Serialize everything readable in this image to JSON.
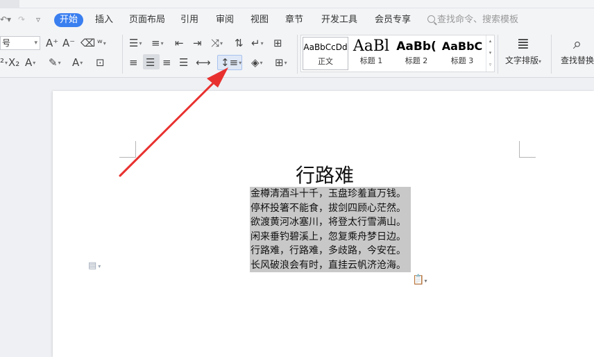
{
  "menu": {
    "tabs": [
      "开始",
      "插入",
      "页面布局",
      "引用",
      "审阅",
      "视图",
      "章节",
      "开发工具",
      "会员专享"
    ],
    "active_tab": "开始",
    "search_placeholder": "查找命令、搜索模板",
    "dropdown_caret": "▾"
  },
  "ribbon": {
    "font_size_value": "号",
    "line_spacing_tooltip": "",
    "styles": [
      {
        "preview": "AaBbCcDd",
        "name": "正文"
      },
      {
        "preview": "AaBl",
        "name": "标题 1"
      },
      {
        "preview": "AaBb(",
        "name": "标题 2"
      },
      {
        "preview": "AaBbC",
        "name": "标题 3"
      }
    ],
    "text_layout_label": "文字排版",
    "find_replace_label": "查找替换"
  },
  "document": {
    "title": "行路难",
    "lines": [
      "金樽清酒斗十千，玉盘珍羞直万钱。",
      "停杯投箸不能食，拔剑四顾心茫然。",
      "欲渡黄河冰塞川，将登太行雪满山。",
      "闲来垂钓碧溪上，忽复乘舟梦日边。",
      "行路难，行路难，多歧路，今安在。",
      "长风破浪会有时，直挂云帆济沧海。"
    ]
  },
  "colors": {
    "accent": "#3a7ff0",
    "selection": "#c8c8c8",
    "annotation_arrow": "#e8312f"
  },
  "icons": [
    "redo-icon",
    "bullet-list-icon",
    "numbered-list-icon",
    "decrease-indent-icon",
    "increase-indent-icon",
    "sort-icon",
    "line-spacing-icon",
    "align-center-icon",
    "search-icon"
  ]
}
